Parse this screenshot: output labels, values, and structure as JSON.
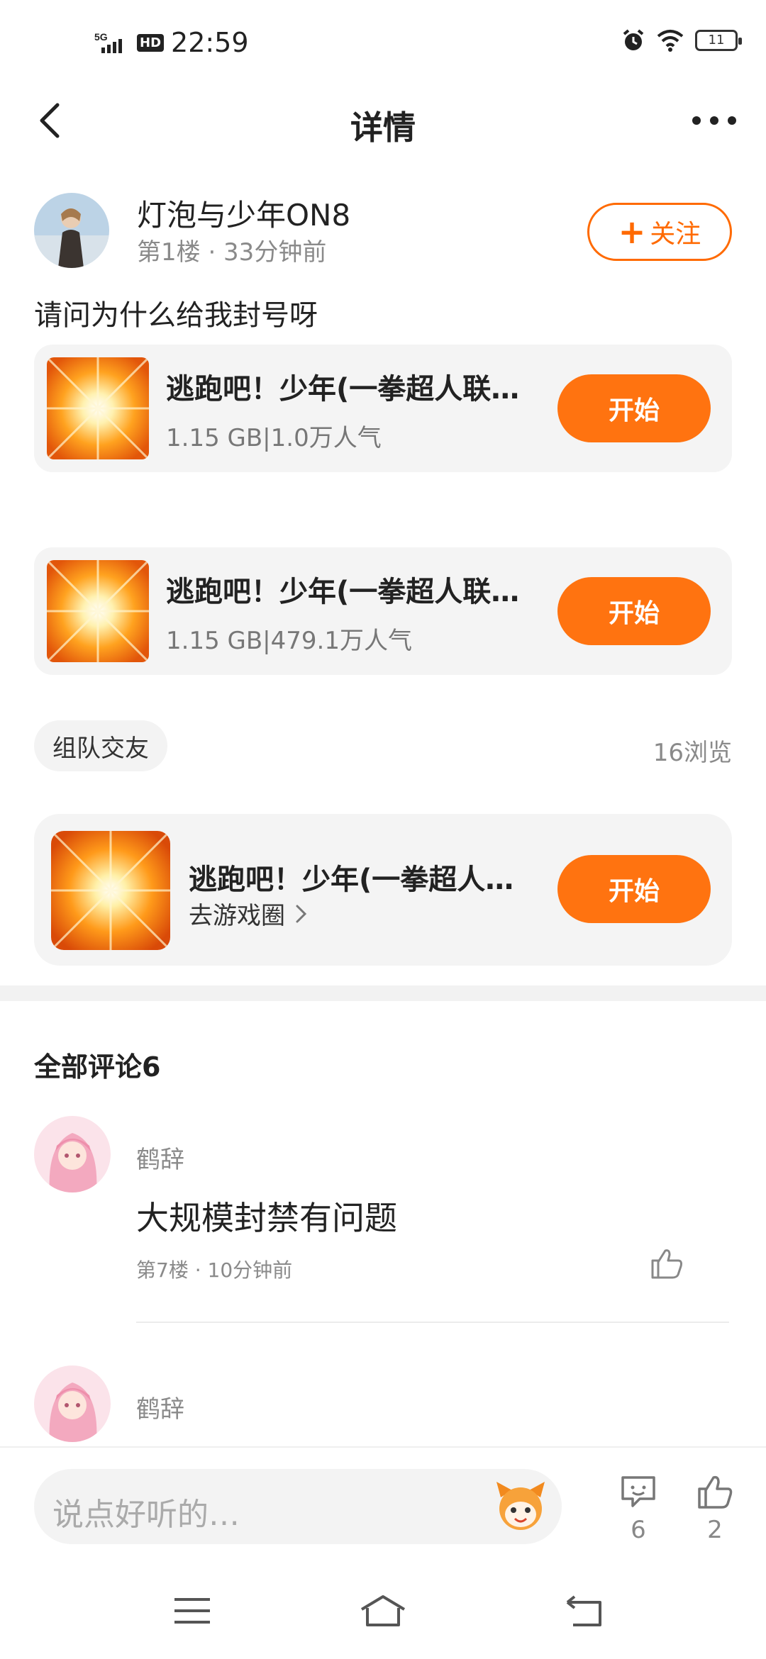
{
  "status_bar": {
    "network": "5G",
    "hd": "HD",
    "time": "22:59",
    "battery": "11"
  },
  "nav": {
    "title": "详情"
  },
  "post": {
    "author": "灯泡与少年ON8",
    "meta": "第1楼 · 33分钟前",
    "follow_label": "关注",
    "text": "请问为什么给我封号呀"
  },
  "games": [
    {
      "title": "逃跑吧！少年(一拳超人联…",
      "meta": "1.15 GB|1.0万人气",
      "button": "开始"
    },
    {
      "title": "逃跑吧！少年(一拳超人联…",
      "meta": "1.15 GB|479.1万人气",
      "button": "开始"
    }
  ],
  "tag": "组队交友",
  "views": "16浏览",
  "circle": {
    "title": "逃跑吧！少年(一拳超人…",
    "link": "去游戏圈",
    "button": "开始"
  },
  "comments": {
    "title": "全部评论6",
    "items": [
      {
        "name": "鹤辞",
        "text": "大规模封禁有问题",
        "meta": "第7楼 · 10分钟前"
      },
      {
        "name": "鹤辞"
      }
    ]
  },
  "bottom": {
    "placeholder": "说点好听的…",
    "comment_count": "6",
    "like_count": "2"
  },
  "colors": {
    "accent": "#ff7310",
    "follow_border": "#ff6a00"
  }
}
